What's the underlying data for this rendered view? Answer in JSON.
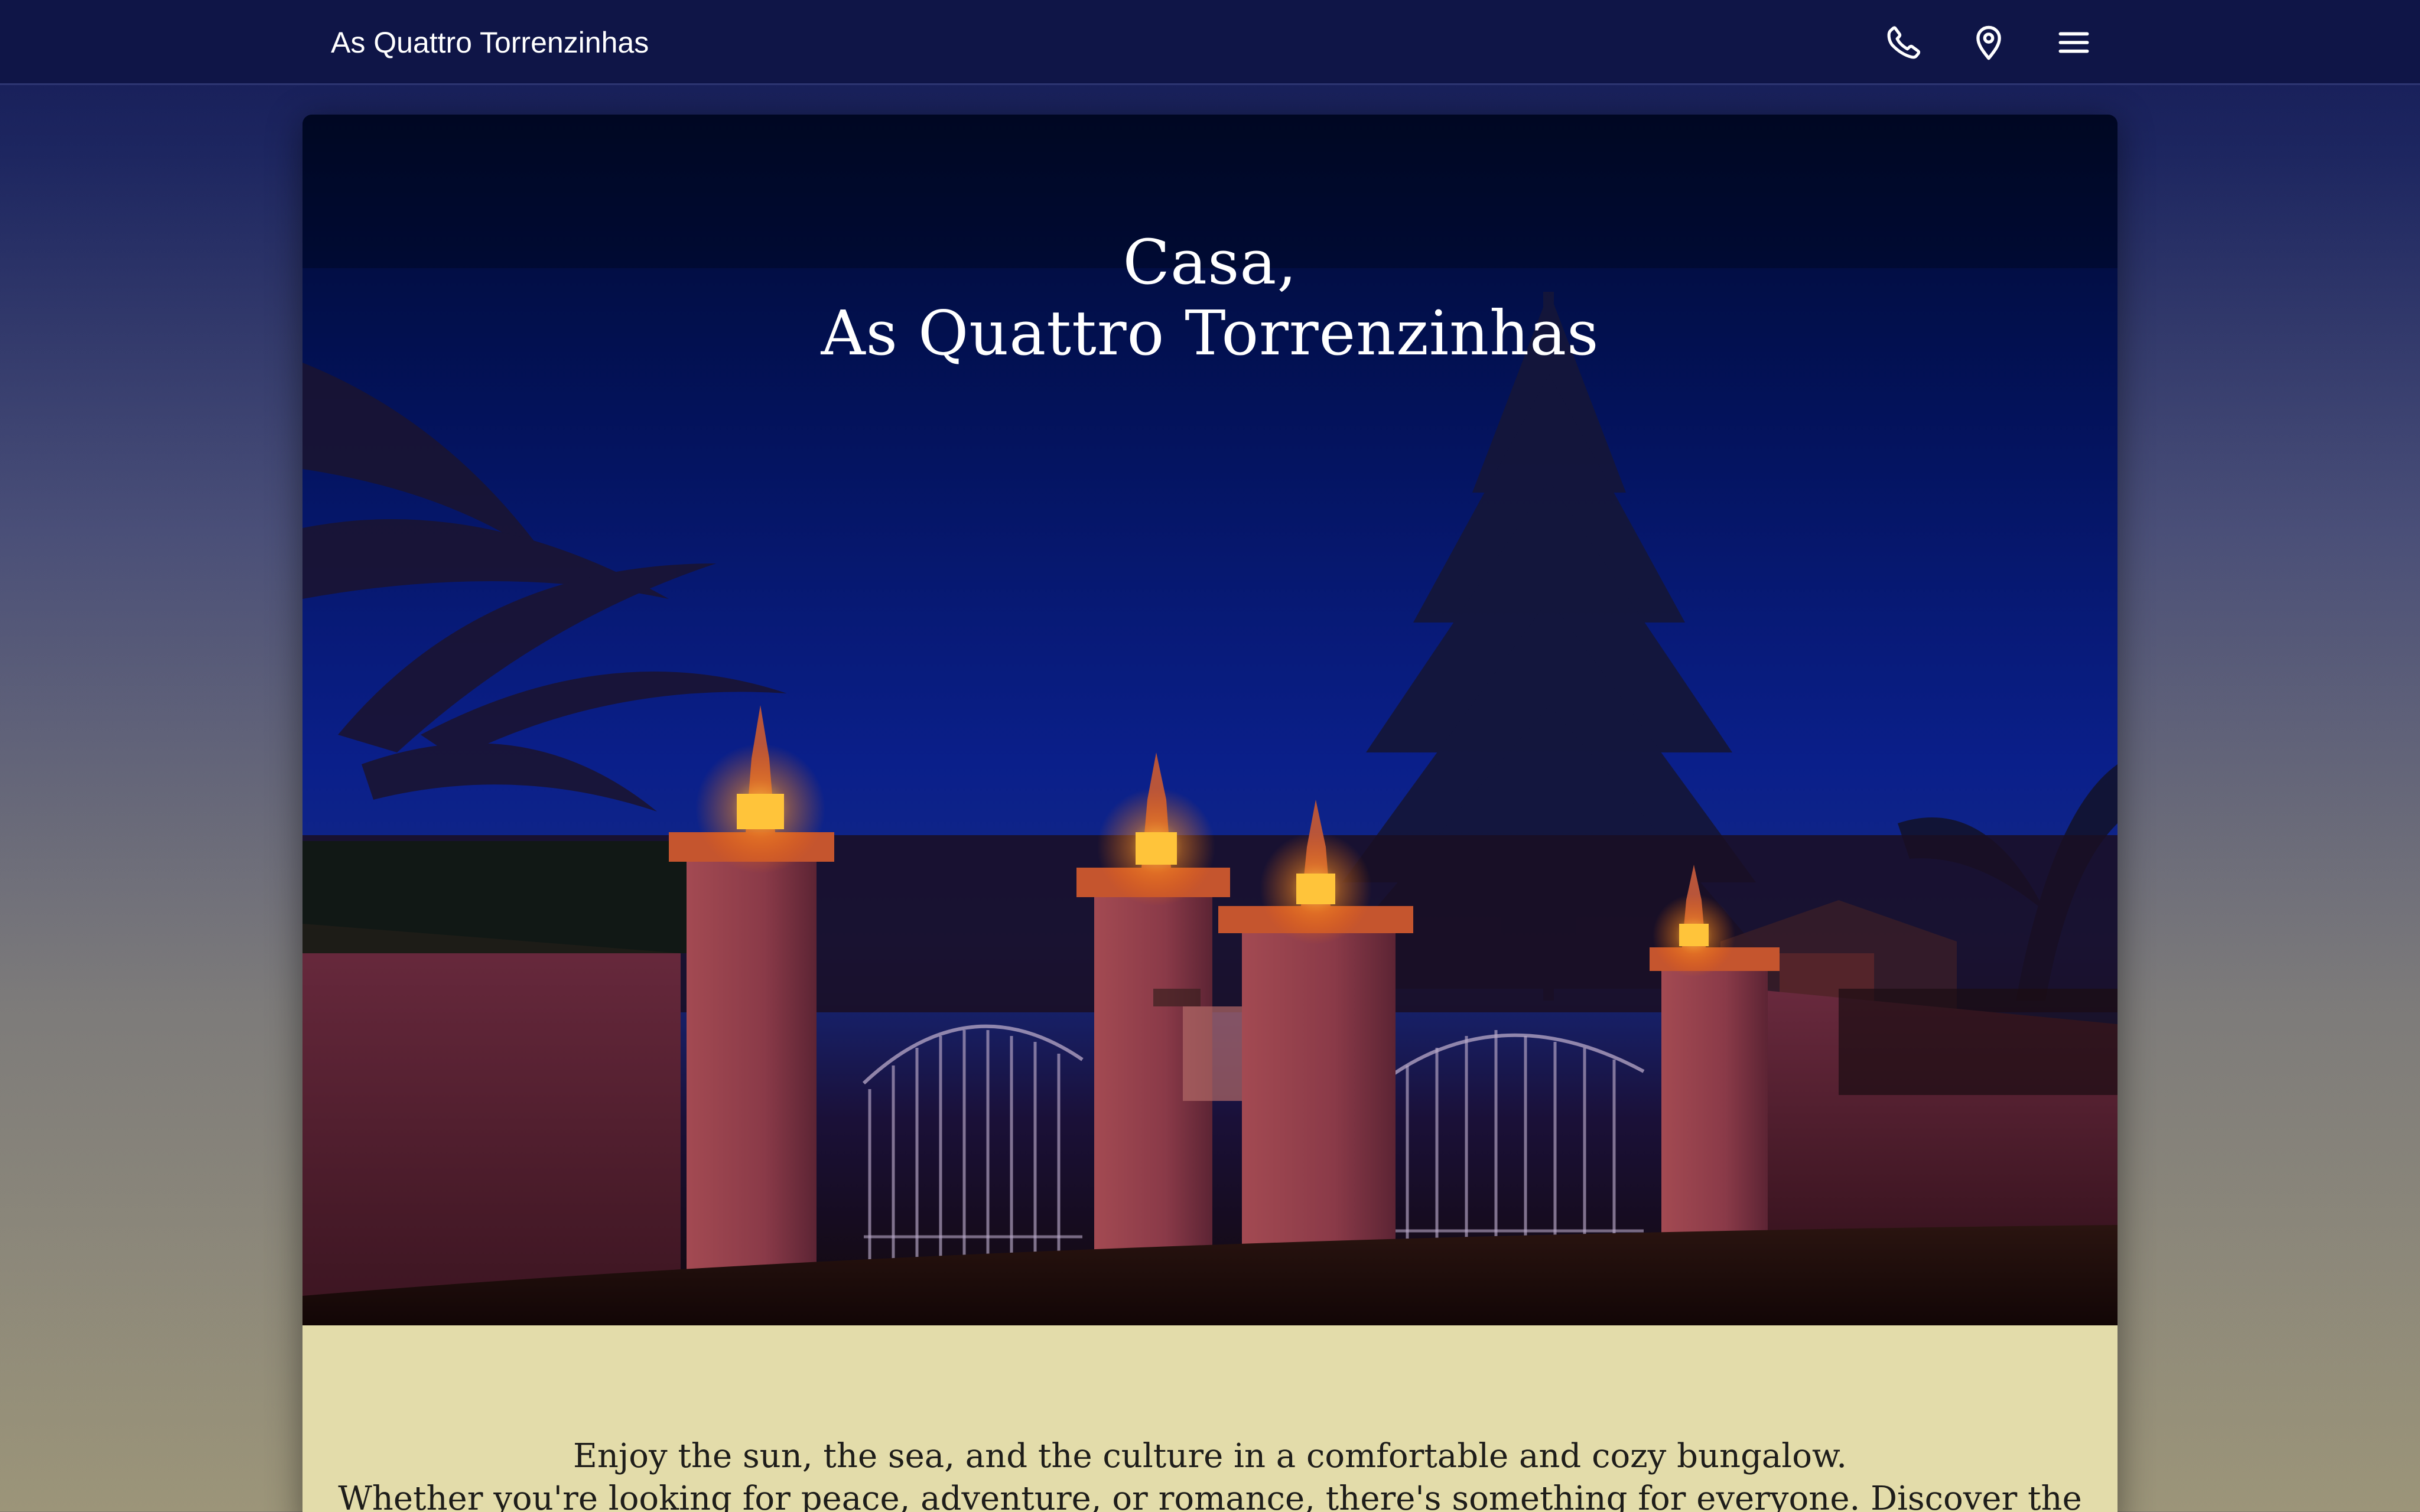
{
  "navbar": {
    "brand": "As Quattro Torrenzinhas",
    "icons": [
      "phone-icon",
      "location-pin-icon",
      "menu-icon"
    ]
  },
  "hero": {
    "title_line1": "Casa,",
    "title_line2": "As Quattro Torrenzinhas"
  },
  "intro": {
    "line1": "Enjoy the sun, the sea, and the culture in a comfortable and cozy bungalow.",
    "line2": "Whether you're looking for peace, adventure, or romance, there's something for everyone. Discover the most"
  },
  "colors": {
    "navbar": "#0f1547",
    "intro_background": "#e3dcaa",
    "lantern_glow": "#ffb020"
  }
}
